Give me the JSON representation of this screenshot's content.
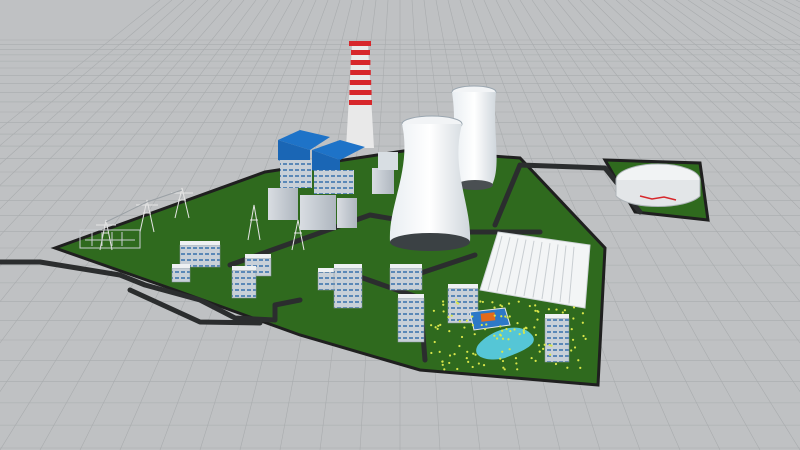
{
  "viewport": {
    "background": "#bfc1c3",
    "grid_color": "#a9acae",
    "grass_color": "#2f6a1e",
    "road_color": "#2b2d2e",
    "roof_blue": "#1e73c8",
    "chimney_red": "#d7272b"
  },
  "scene": {
    "label": "",
    "objects": [
      "chimney",
      "cooling-tower",
      "cooling-tower",
      "boiler-house",
      "turbine-hall",
      "transmission-tower",
      "switchyard",
      "office-building",
      "dormitory-building",
      "sports-court",
      "pond",
      "oil-storage-tank",
      "coal-yard"
    ]
  }
}
